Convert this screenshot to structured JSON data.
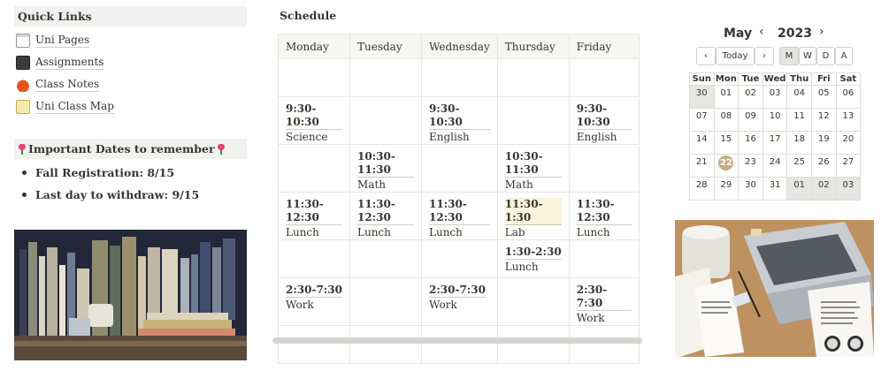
{
  "quick_links": {
    "title": "Quick Links",
    "items": [
      {
        "label": "Uni Pages",
        "icon": "page-icon"
      },
      {
        "label": "Assignments",
        "icon": "book-icon"
      },
      {
        "label": "Class Notes",
        "icon": "coffee-icon"
      },
      {
        "label": "Uni Class Map",
        "icon": "memo-icon"
      }
    ]
  },
  "important_dates": {
    "title": "Important Dates to remember",
    "icon": "tulip-icon",
    "items": [
      {
        "text": "Fall Registration:  8/15"
      },
      {
        "text": "Last day to withdraw:  9/15"
      }
    ]
  },
  "schedule": {
    "title": "Schedule",
    "columns": [
      "Monday",
      "Tuesday",
      "Wednesday",
      "Thursday",
      "Friday"
    ],
    "rows": [
      [
        {
          "time": "",
          "label": ""
        },
        {
          "time": "",
          "label": ""
        },
        {
          "time": "",
          "label": ""
        },
        {
          "time": "",
          "label": ""
        },
        {
          "time": "",
          "label": ""
        }
      ],
      [
        {
          "time": "9:30- 10:30",
          "label": "Science"
        },
        {
          "time": "",
          "label": ""
        },
        {
          "time": "9:30- 10:30",
          "label": "English"
        },
        {
          "time": "",
          "label": ""
        },
        {
          "time": "9:30- 10:30",
          "label": "English"
        }
      ],
      [
        {
          "time": "",
          "label": ""
        },
        {
          "time": "10:30-11:30",
          "label": "Math"
        },
        {
          "time": "",
          "label": ""
        },
        {
          "time": "10:30-11:30",
          "label": "Math"
        },
        {
          "time": "",
          "label": ""
        }
      ],
      [
        {
          "time": "11:30-12:30",
          "label": "Lunch"
        },
        {
          "time": "11:30-12:30",
          "label": "Lunch"
        },
        {
          "time": "11:30-12:30",
          "label": "Lunch"
        },
        {
          "time": "11:30-1:30",
          "label": "Lab",
          "highlight": true
        },
        {
          "time": "11:30-12:30",
          "label": "Lunch"
        }
      ],
      [
        {
          "time": "",
          "label": ""
        },
        {
          "time": "",
          "label": ""
        },
        {
          "time": "",
          "label": ""
        },
        {
          "time": "1:30-2:30",
          "label": "Lunch"
        },
        {
          "time": "",
          "label": ""
        }
      ],
      [
        {
          "time": "2:30-7:30",
          "label": "Work"
        },
        {
          "time": "",
          "label": ""
        },
        {
          "time": "2:30-7:30",
          "label": "Work"
        },
        {
          "time": "",
          "label": ""
        },
        {
          "time": "2:30-7:30",
          "label": "Work"
        }
      ],
      [
        {
          "time": "",
          "label": ""
        },
        {
          "time": "",
          "label": ""
        },
        {
          "time": "",
          "label": ""
        },
        {
          "time": "",
          "label": ""
        },
        {
          "time": "",
          "label": ""
        }
      ]
    ]
  },
  "calendar": {
    "month": "May",
    "year": "2023",
    "prev": "‹",
    "next": "›",
    "today_label": "Today",
    "nav_prev": "‹",
    "nav_next": "›",
    "views": [
      {
        "label": "M",
        "selected": true
      },
      {
        "label": "W"
      },
      {
        "label": "D"
      },
      {
        "label": "A"
      }
    ],
    "weekdays": [
      "Sun",
      "Mon",
      "Tue",
      "Wed",
      "Thu",
      "Fri",
      "Sat"
    ],
    "weeks": [
      [
        {
          "d": "30",
          "other": true
        },
        {
          "d": "01"
        },
        {
          "d": "02"
        },
        {
          "d": "03"
        },
        {
          "d": "04"
        },
        {
          "d": "05"
        },
        {
          "d": "06"
        }
      ],
      [
        {
          "d": "07"
        },
        {
          "d": "08"
        },
        {
          "d": "09"
        },
        {
          "d": "10"
        },
        {
          "d": "11"
        },
        {
          "d": "12"
        },
        {
          "d": "13"
        }
      ],
      [
        {
          "d": "14"
        },
        {
          "d": "15"
        },
        {
          "d": "16"
        },
        {
          "d": "17"
        },
        {
          "d": "18"
        },
        {
          "d": "19"
        },
        {
          "d": "20"
        }
      ],
      [
        {
          "d": "21"
        },
        {
          "d": "22",
          "today": true
        },
        {
          "d": "23"
        },
        {
          "d": "24"
        },
        {
          "d": "25"
        },
        {
          "d": "26"
        },
        {
          "d": "27"
        }
      ],
      [
        {
          "d": "28"
        },
        {
          "d": "29"
        },
        {
          "d": "30"
        },
        {
          "d": "31"
        },
        {
          "d": "01",
          "other": true
        },
        {
          "d": "02",
          "other": true
        },
        {
          "d": "03",
          "other": true
        }
      ]
    ],
    "today_color": "#c7ab85"
  }
}
